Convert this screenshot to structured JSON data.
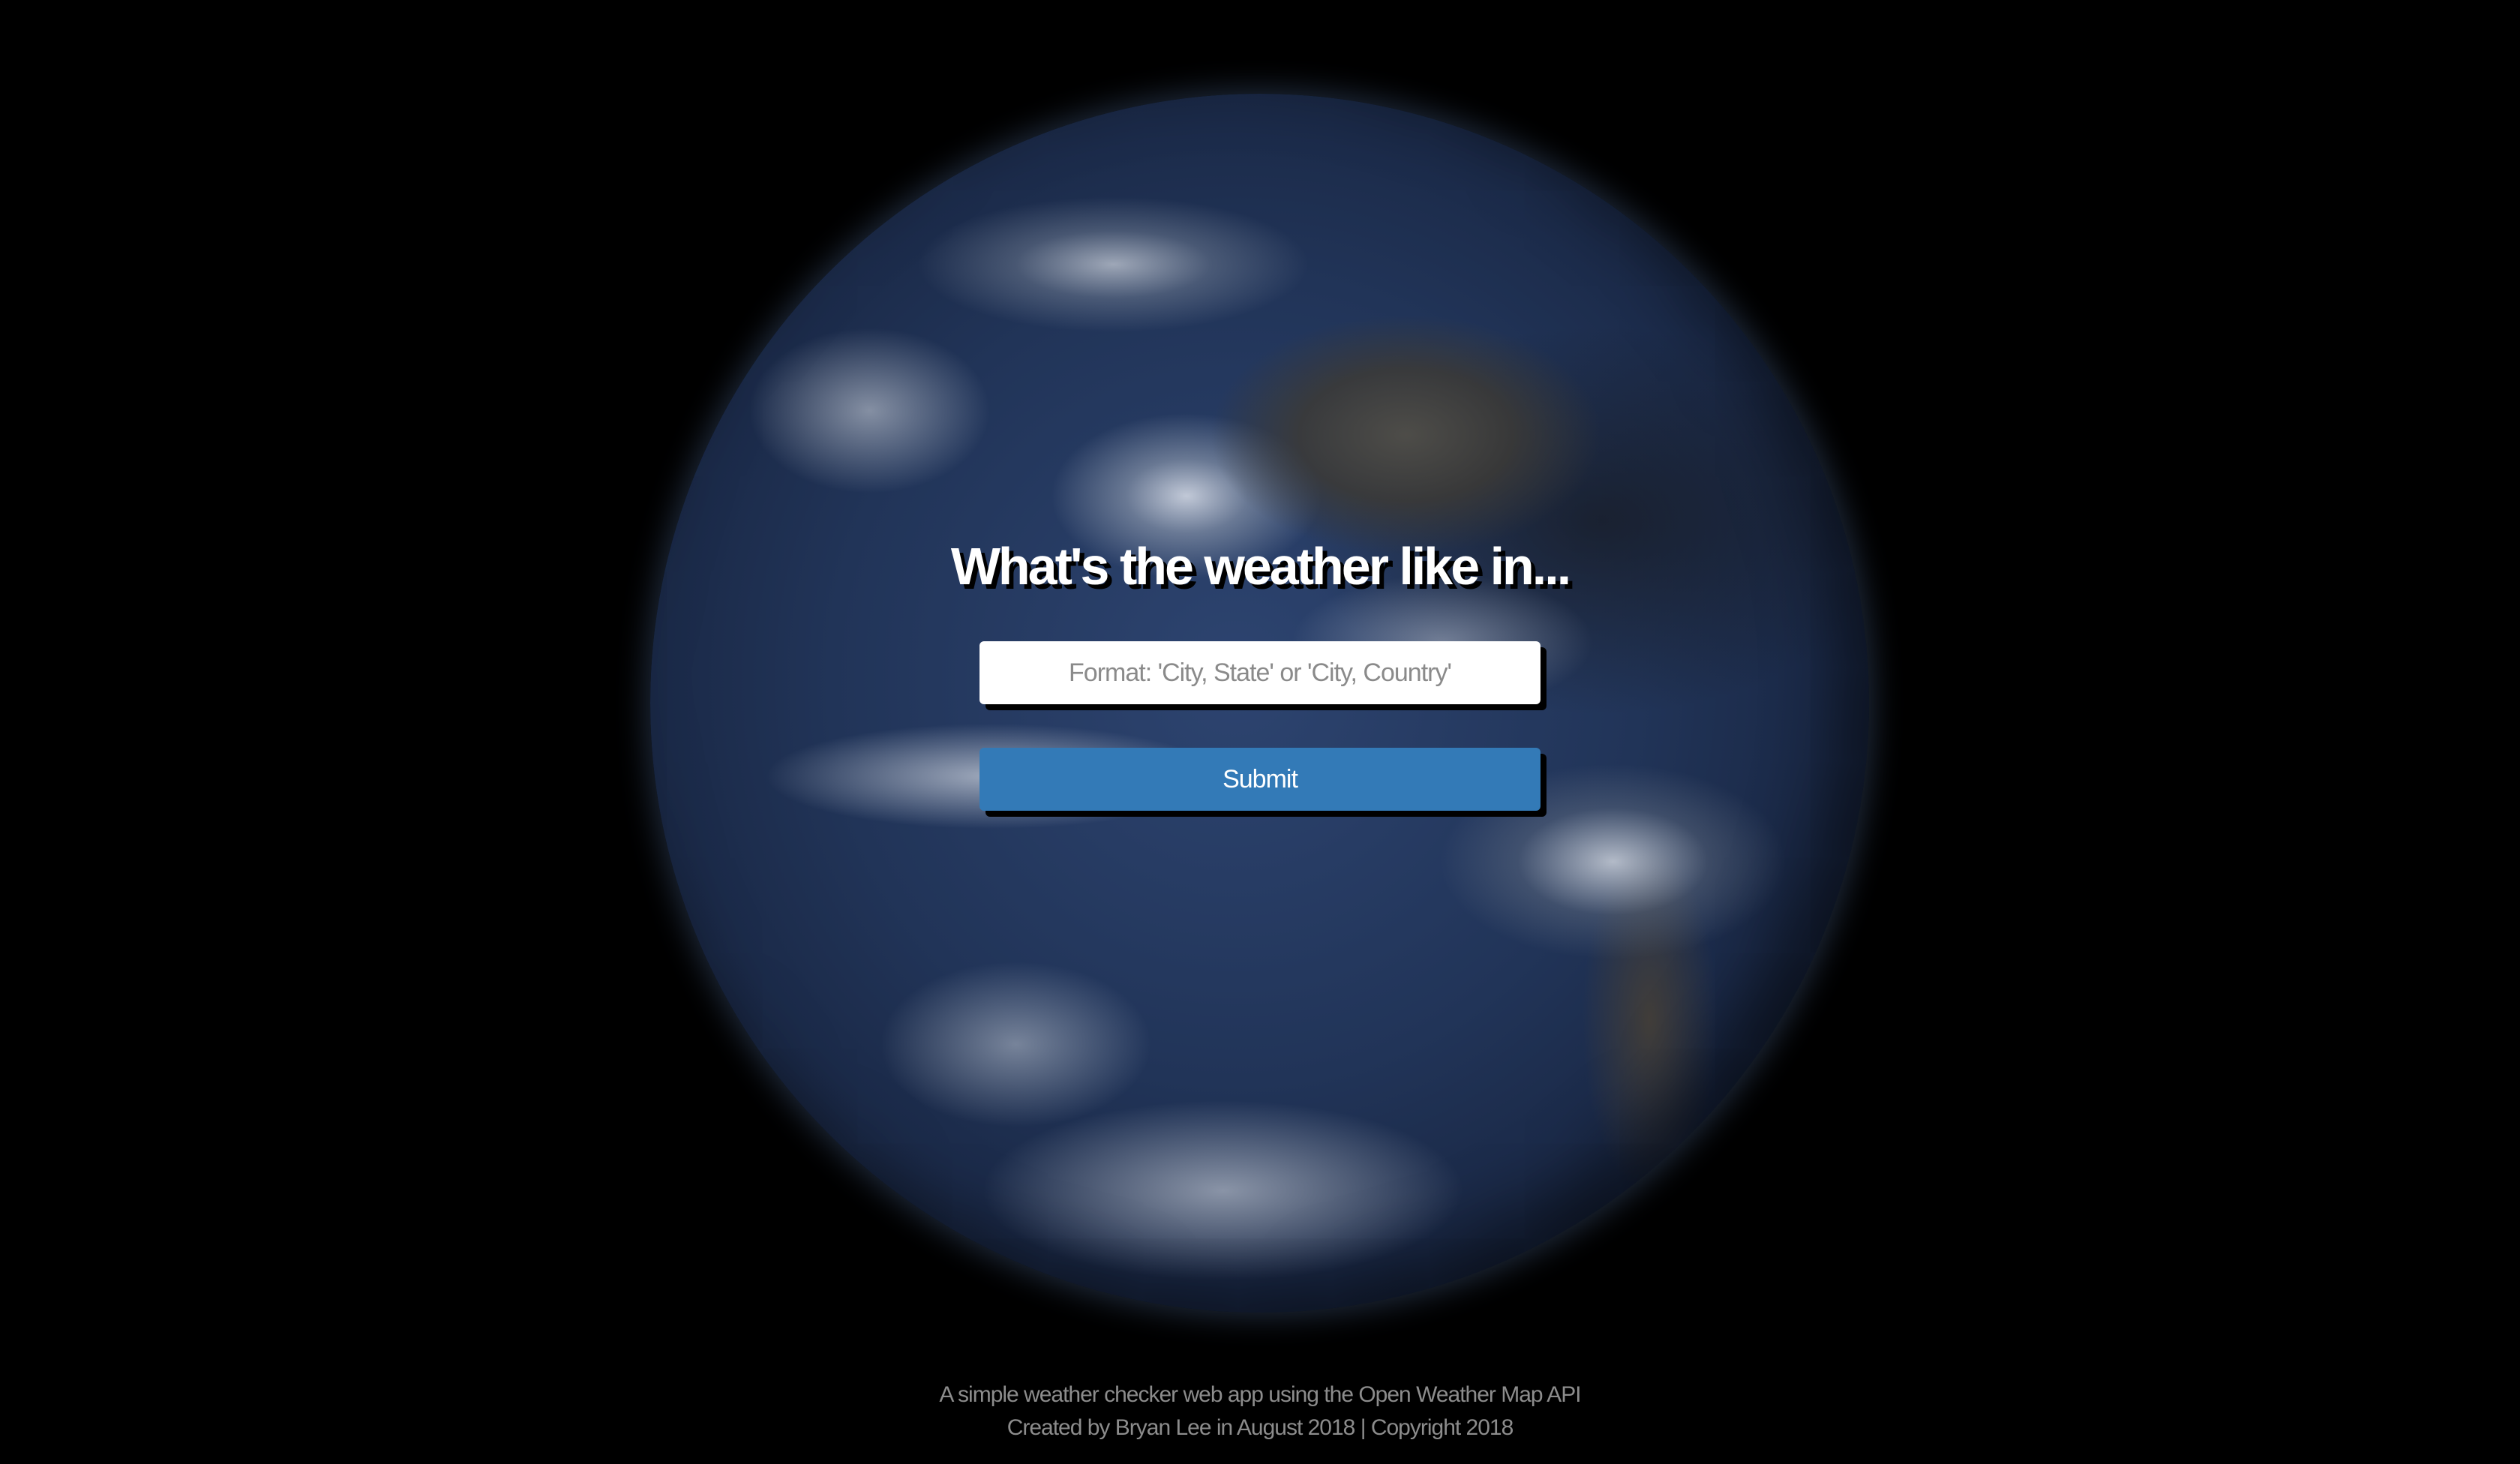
{
  "page": {
    "background_color": "#000000",
    "background_image": "earth-globe"
  },
  "form": {
    "heading": "What's the weather like in...",
    "input_placeholder": "Format: 'City, State' or 'City, Country'",
    "input_value": "",
    "submit_label": "Submit",
    "submit_color": "#337ab7"
  },
  "footer": {
    "line1": "A simple weather checker web app using the Open Weather Map API",
    "line2": "Created by Bryan Lee in August 2018 | Copyright 2018"
  }
}
